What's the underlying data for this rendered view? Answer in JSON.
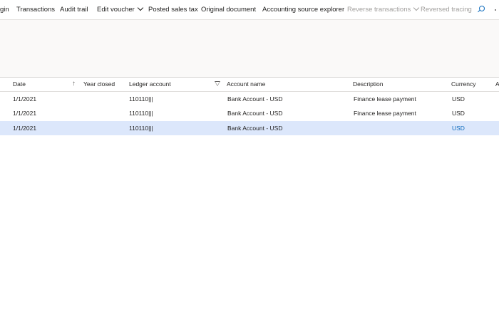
{
  "toolbar": {
    "items": [
      {
        "label": "gin"
      },
      {
        "label": "Transactions"
      },
      {
        "label": "Audit trail"
      },
      {
        "label": "Edit voucher"
      },
      {
        "label": "Posted sales tax"
      },
      {
        "label": "Original document"
      },
      {
        "label": "Accounting source explorer"
      },
      {
        "label": "Reverse transactions"
      },
      {
        "label": "Reversed tracing"
      }
    ],
    "search_icon": "search-icon",
    "more_icon": "more-icon"
  },
  "grid": {
    "columns": [
      "Date",
      "Year closed",
      "Ledger account",
      "Account name",
      "Description",
      "Currency",
      "A"
    ],
    "rows": [
      {
        "date": "1/1/2021",
        "year_closed": "",
        "ledger_account": "110110|||",
        "account_name": "Bank Account - USD",
        "description": "Finance lease payment",
        "currency": "USD"
      },
      {
        "date": "1/1/2021",
        "year_closed": "",
        "ledger_account": "110110|||",
        "account_name": "Bank Account - USD",
        "description": "Finance lease payment",
        "currency": "USD"
      },
      {
        "date": "1/1/2021",
        "year_closed": "",
        "ledger_account": "110110|||",
        "account_name": "Bank Account - USD",
        "description": "",
        "currency": "USD"
      }
    ]
  },
  "colors": {
    "selected_row": "#dce7fb",
    "accent": "#0f6cbd",
    "disabled_text": "#a19f9d",
    "header_pane": "#faf9f8"
  }
}
